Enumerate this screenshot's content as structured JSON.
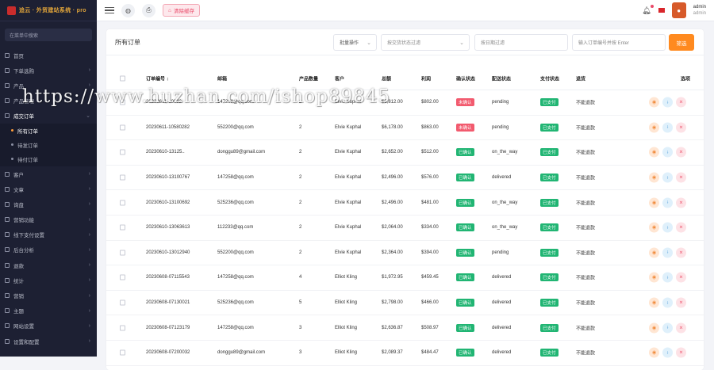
{
  "brand": {
    "name": "追云 · 外贸建站系统 · pro"
  },
  "sidebar": {
    "search_placeholder": "在菜单中搜索",
    "items": [
      {
        "label": "首页",
        "chevron": false
      },
      {
        "label": "下单选购",
        "chevron": true
      },
      {
        "label": "产品",
        "chevron": true
      },
      {
        "label": "产品管理",
        "chevron": true
      },
      {
        "label": "成交订单",
        "chevron": true,
        "active": true
      }
    ],
    "sub_items": [
      {
        "label": "所有订单",
        "current": true
      },
      {
        "label": "待发订单",
        "current": false
      },
      {
        "label": "待付订单",
        "current": false
      }
    ],
    "items_after": [
      {
        "label": "客户"
      },
      {
        "label": "文章"
      },
      {
        "label": "询盘"
      },
      {
        "label": "营销功能"
      },
      {
        "label": "线下支付设置"
      },
      {
        "label": "后台分析"
      },
      {
        "label": "退款"
      },
      {
        "label": "统计"
      },
      {
        "label": "营销"
      },
      {
        "label": "主题"
      },
      {
        "label": "网站设置"
      },
      {
        "label": "设置和配置"
      }
    ]
  },
  "topbar": {
    "clear_cache": "清除缓存",
    "user_name": "admin",
    "user_role": "admin"
  },
  "card": {
    "title": "所有订单",
    "bulk_action": "批量操作",
    "status_placeholder": "按交货状态过滤",
    "pay_placeholder": "按日期过滤",
    "order_placeholder": "输入订单编号并按 Enter",
    "filter_button": "筛选"
  },
  "table": {
    "headers": [
      "订单编号 ↕",
      "邮箱",
      "产品数量",
      "客户",
      "总额",
      "利润",
      "确认状态",
      "配送状态",
      "支付状态",
      "退货",
      "选项"
    ],
    "rows": [
      {
        "order": "20230611-10092",
        "email": "147258@qq.com",
        "qty": "2",
        "customer": "Elvie Kuphal",
        "total": "$5,812.00",
        "profit": "$802.00",
        "confirm": "未确认",
        "confirm_color": "red",
        "delivery": "pending",
        "payment": "已支付",
        "refund": "不能退款"
      },
      {
        "order": "20230611-10580282",
        "email": "552200@qq.com",
        "qty": "2",
        "customer": "Elvie Kuphal",
        "total": "$6,178.00",
        "profit": "$863.00",
        "confirm": "未确认",
        "confirm_color": "red",
        "delivery": "pending",
        "payment": "已支付",
        "refund": "不能退款"
      },
      {
        "order": "20230610-13125..",
        "email": "donggu89@gmail.com",
        "qty": "2",
        "customer": "Elvie Kuphal",
        "total": "$2,652.00",
        "profit": "$512.00",
        "confirm": "已确认",
        "confirm_color": "green",
        "delivery": "on_the_way",
        "payment": "已支付",
        "refund": "不能退款"
      },
      {
        "order": "20230610-13100767",
        "email": "147258@qq.com",
        "qty": "2",
        "customer": "Elvie Kuphal",
        "total": "$2,496.00",
        "profit": "$576.00",
        "confirm": "已确认",
        "confirm_color": "green",
        "delivery": "delivered",
        "payment": "已支付",
        "refund": "不能退款"
      },
      {
        "order": "20230610-13100692",
        "email": "525236@qq.com",
        "qty": "2",
        "customer": "Elvie Kuphal",
        "total": "$2,496.00",
        "profit": "$481.00",
        "confirm": "已确认",
        "confirm_color": "green",
        "delivery": "on_the_way",
        "payment": "已支付",
        "refund": "不能退款"
      },
      {
        "order": "20230610-13063613",
        "email": "112233@qq.com",
        "qty": "2",
        "customer": "Elvie Kuphal",
        "total": "$2,064.00",
        "profit": "$334.00",
        "confirm": "已确认",
        "confirm_color": "green",
        "delivery": "on_the_way",
        "payment": "已支付",
        "refund": "不能退款"
      },
      {
        "order": "20230610-13012940",
        "email": "552200@qq.com",
        "qty": "2",
        "customer": "Elvie Kuphal",
        "total": "$2,364.00",
        "profit": "$394.00",
        "confirm": "已确认",
        "confirm_color": "green",
        "delivery": "pending",
        "payment": "已支付",
        "refund": "不能退款"
      },
      {
        "order": "20230608-07115543",
        "email": "147258@qq.com",
        "qty": "4",
        "customer": "Elliot Kling",
        "total": "$1,972.95",
        "profit": "$459.45",
        "confirm": "已确认",
        "confirm_color": "green",
        "delivery": "delivered",
        "payment": "已支付",
        "refund": "不能退款"
      },
      {
        "order": "20230608-07130021",
        "email": "525236@qq.com",
        "qty": "5",
        "customer": "Elliot Kling",
        "total": "$2,798.00",
        "profit": "$466.00",
        "confirm": "已确认",
        "confirm_color": "green",
        "delivery": "delivered",
        "payment": "已支付",
        "refund": "不能退款"
      },
      {
        "order": "20230608-07123179",
        "email": "147258@qq.com",
        "qty": "3",
        "customer": "Elliot Kling",
        "total": "$2,636.87",
        "profit": "$508.97",
        "confirm": "已确认",
        "confirm_color": "green",
        "delivery": "delivered",
        "payment": "已支付",
        "refund": "不能退款"
      },
      {
        "order": "20230608-07200032",
        "email": "donggu89@gmail.com",
        "qty": "3",
        "customer": "Elliot Kling",
        "total": "$2,089.37",
        "profit": "$484.47",
        "confirm": "已确认",
        "confirm_color": "green",
        "delivery": "delivered",
        "payment": "已支付",
        "refund": "不能退款"
      }
    ]
  },
  "watermark": "https://www.huzhan.com/ishop89845",
  "colors": {
    "sidebar_bg": "#1d2033",
    "accent": "#ff8a1f",
    "confirmed": "#21b573",
    "unconfirmed": "#f25a6e"
  }
}
